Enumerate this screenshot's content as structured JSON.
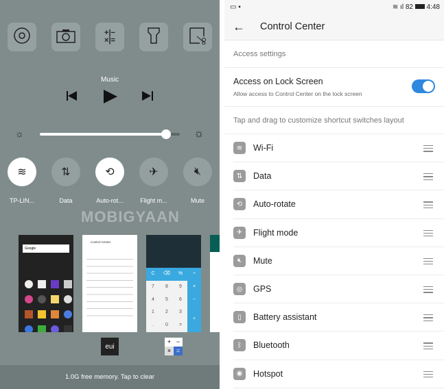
{
  "left": {
    "shortcuts": [
      {
        "icon": "remote-control-icon"
      },
      {
        "icon": "camera-icon"
      },
      {
        "icon": "calculator-icon"
      },
      {
        "icon": "flashlight-icon"
      },
      {
        "icon": "screenshot-icon"
      }
    ],
    "music_label": "Music",
    "brightness": 0.9,
    "toggles": [
      {
        "label": "TP-LIN...",
        "icon": "wifi-icon",
        "on": true
      },
      {
        "label": "Data",
        "icon": "data-icon",
        "on": false
      },
      {
        "label": "Auto-rot...",
        "icon": "auto-rotate-icon",
        "on": true
      },
      {
        "label": "Flight m...",
        "icon": "airplane-icon",
        "on": false
      },
      {
        "label": "Mute",
        "icon": "mute-icon",
        "on": false
      }
    ],
    "watermark": "MOBIGYAAN",
    "recent_apps": {
      "home_search": "Google",
      "cc_title": "Control Center",
      "calc_keys": [
        "C",
        "⌫",
        "%",
        "÷",
        "7",
        "8",
        "9",
        "×",
        "4",
        "5",
        "6",
        "−",
        "1",
        "2",
        "3",
        "+",
        ".",
        "0",
        "="
      ],
      "app_icons": [
        "eui-logo",
        "calculator-app-icon"
      ]
    },
    "memory_text": "1.0G free memory. Tap to clear"
  },
  "right": {
    "status": {
      "battery": "82",
      "time": "4:48"
    },
    "title": "Control Center",
    "section1": "Access settings",
    "lock_title": "Access on Lock Screen",
    "lock_sub": "Allow access to Control Center on the lock screen",
    "lock_enabled": true,
    "accent": "#2d88de",
    "section2": "Tap and drag to customize shortcut switches layout",
    "items": [
      {
        "label": "Wi-Fi",
        "icon": "wifi-icon"
      },
      {
        "label": "Data",
        "icon": "data-icon"
      },
      {
        "label": "Auto-rotate",
        "icon": "auto-rotate-icon"
      },
      {
        "label": "Flight mode",
        "icon": "airplane-icon"
      },
      {
        "label": "Mute",
        "icon": "mute-icon"
      },
      {
        "label": "GPS",
        "icon": "gps-icon"
      },
      {
        "label": "Battery assistant",
        "icon": "battery-icon"
      },
      {
        "label": "Bluetooth",
        "icon": "bluetooth-icon"
      },
      {
        "label": "Hotspot",
        "icon": "hotspot-icon"
      }
    ]
  }
}
